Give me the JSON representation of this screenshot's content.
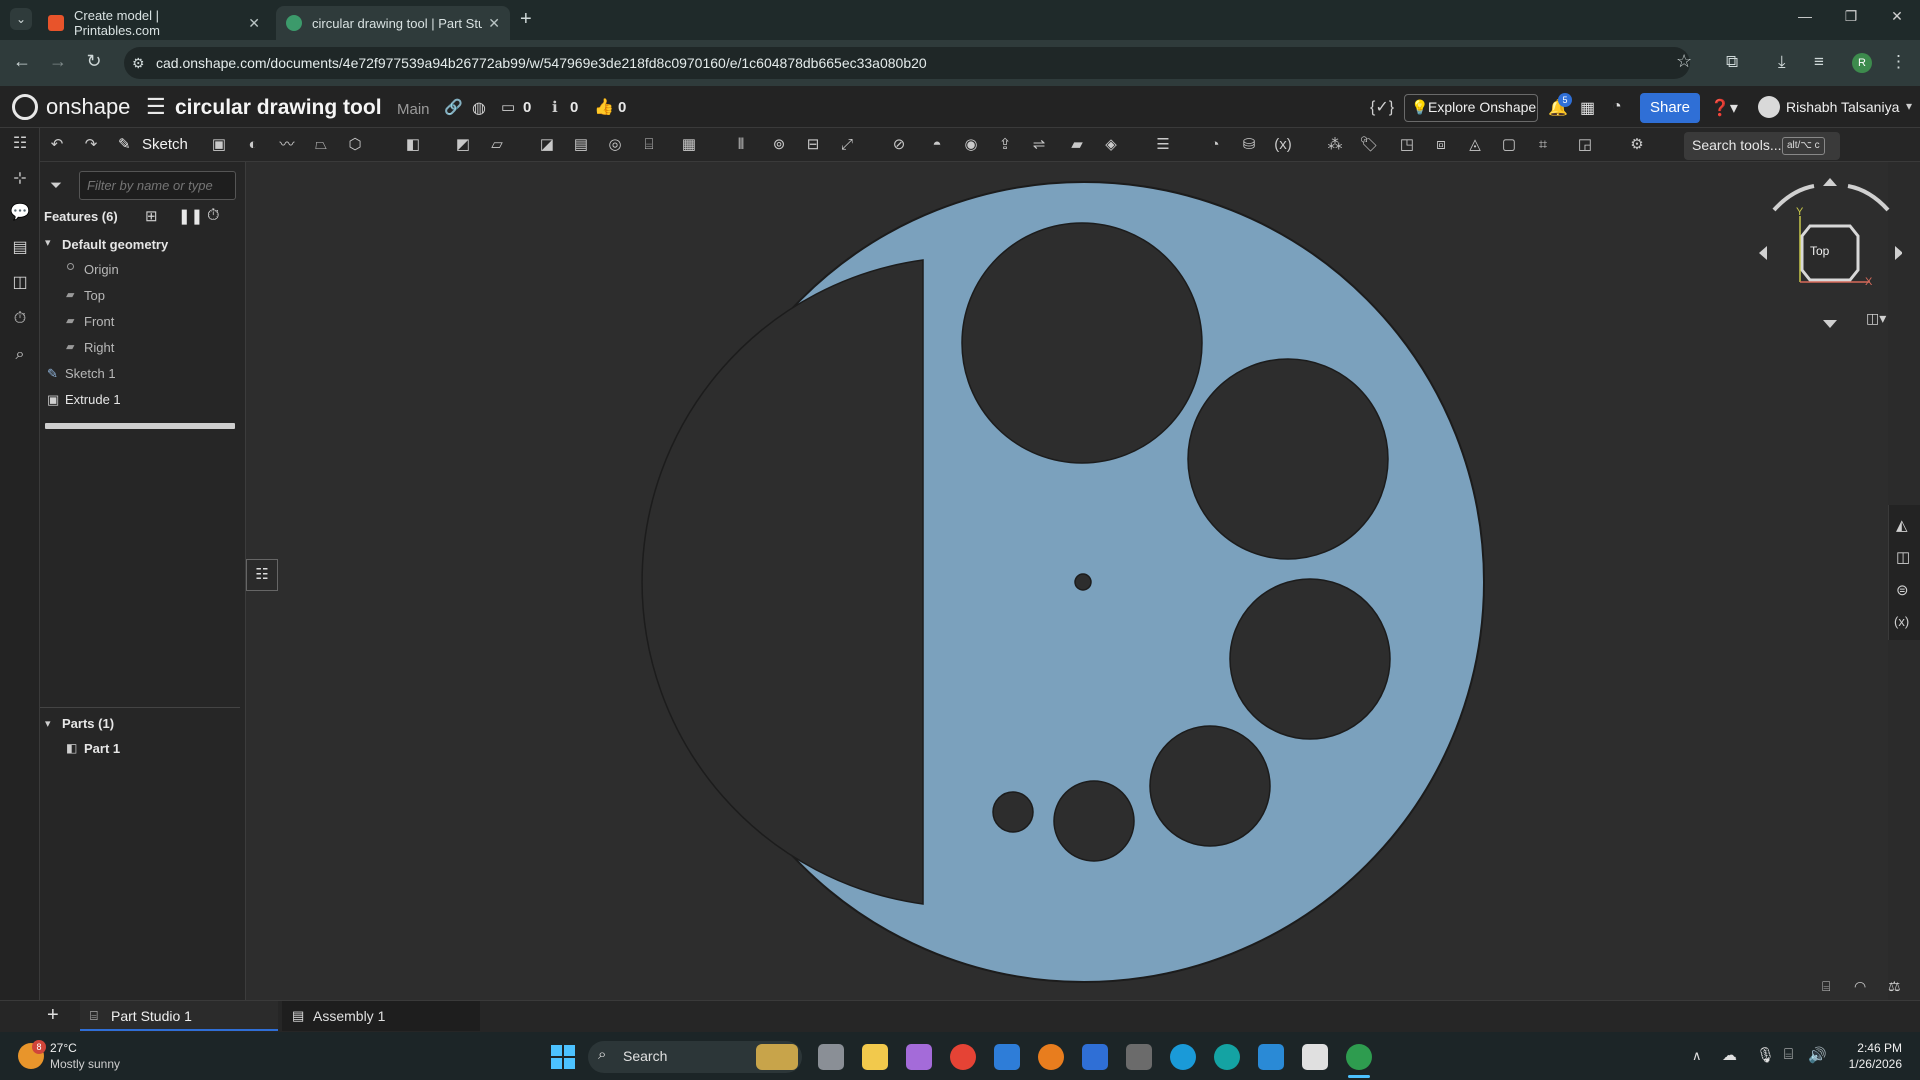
{
  "browser": {
    "tabs": [
      {
        "title": "Create model | Printables.com",
        "active": false
      },
      {
        "title": "circular drawing tool | Part Stud",
        "active": true
      }
    ],
    "url": "cad.onshape.com/documents/4e72f977539a94b26772ab99/w/547969e3de218fd8c0970160/e/1c604878db665ec33a080b20",
    "profile_initial": "R"
  },
  "onshape": {
    "brand": "onshape",
    "doc_title": "circular drawing tool",
    "branch": "Main",
    "counts": {
      "versions": "0",
      "notifications_inline": "0",
      "likes": "0"
    },
    "explore_label": "Explore Onshape",
    "notif_badge": "5",
    "share_label": "Share",
    "user_name": "Rishabh Talsaniya",
    "sketch_label": "Sketch",
    "search_tools": "Search tools...",
    "search_shortcut": "alt/⌥ c"
  },
  "feature_panel": {
    "filter_placeholder": "Filter by name or type",
    "features_label": "Features (6)",
    "default_geometry": "Default geometry",
    "items": [
      "Origin",
      "Top",
      "Front",
      "Right"
    ],
    "sketch": "Sketch 1",
    "extrude": "Extrude 1",
    "parts_label": "Parts (1)",
    "part": "Part 1"
  },
  "view_cube": {
    "face": "Top",
    "axis_y": "Y",
    "axis_x": "X"
  },
  "bottom_tabs": [
    {
      "label": "Part Studio 1",
      "active": true
    },
    {
      "label": "Assembly 1",
      "active": false
    }
  ],
  "taskbar": {
    "weather_temp": "27°C",
    "weather_desc": "Mostly sunny",
    "weather_badge": "8",
    "search_label": "Search",
    "time": "2:46 PM",
    "date": "1/26/2026"
  },
  "colors": {
    "part_fill": "#7ba1bd",
    "hole_fill": "#2d2d2d",
    "share_btn": "#2f6fd6"
  }
}
